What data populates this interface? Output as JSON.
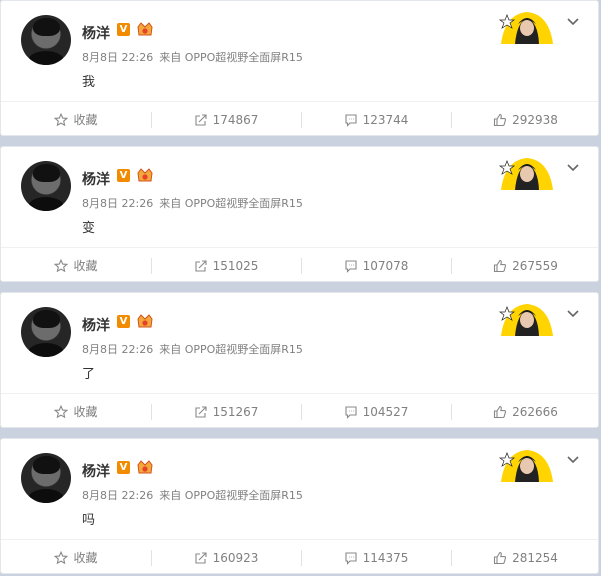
{
  "posts": [
    {
      "username": "杨洋",
      "verified_badge": "V",
      "date": "8月8日 22:26",
      "source": "来自 OPPO超视野全面屏R15",
      "text": "我",
      "actions": {
        "favorite": "收藏",
        "repost": "174867",
        "comment": "123744",
        "like": "292938"
      }
    },
    {
      "username": "杨洋",
      "verified_badge": "V",
      "date": "8月8日 22:26",
      "source": "来自 OPPO超视野全面屏R15",
      "text": "变",
      "actions": {
        "favorite": "收藏",
        "repost": "151025",
        "comment": "107078",
        "like": "267559"
      }
    },
    {
      "username": "杨洋",
      "verified_badge": "V",
      "date": "8月8日 22:26",
      "source": "来自 OPPO超视野全面屏R15",
      "text": "了",
      "actions": {
        "favorite": "收藏",
        "repost": "151267",
        "comment": "104527",
        "like": "262666"
      }
    },
    {
      "username": "杨洋",
      "verified_badge": "V",
      "date": "8月8日 22:26",
      "source": "来自 OPPO超视野全面屏R15",
      "text": "吗",
      "actions": {
        "favorite": "收藏",
        "repost": "160923",
        "comment": "114375",
        "like": "281254"
      }
    }
  ],
  "icons": {
    "favorite": "star-icon",
    "repost": "share-icon",
    "comment": "comment-icon",
    "like": "thumbs-up-icon",
    "menu": "chevron-down-icon",
    "verified": "verified-badge-icon",
    "vip": "vip-crown-icon"
  },
  "colors": {
    "page_background": "#c9d2de",
    "card_background": "#ffffff",
    "username": "#333333",
    "meta_text": "#808080",
    "verified_badge": "#f28b00",
    "decor_yellow": "#ffd400"
  }
}
